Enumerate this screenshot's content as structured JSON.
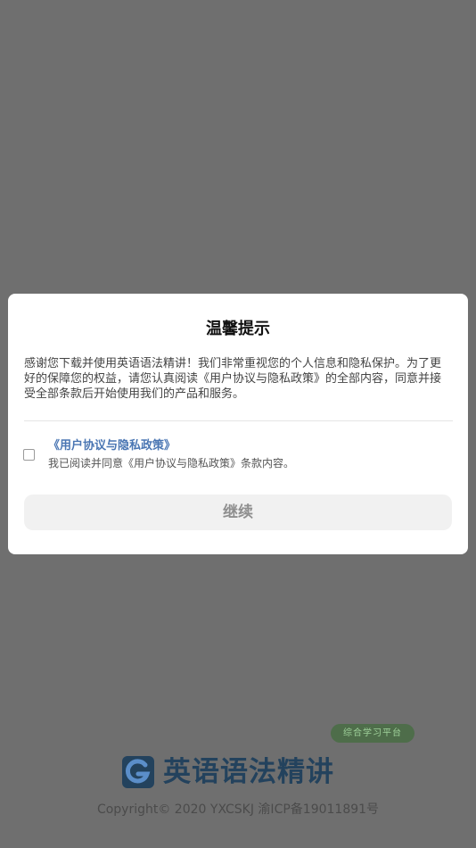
{
  "dialog": {
    "title": "温馨提示",
    "body": "感谢您下载并使用英语语法精讲！我们非常重视您的个人信息和隐私保护。为了更好的保障您的权益，请您认真阅读《用户协议与隐私政策》的全部内容，同意并接受全部条款后开始使用我们的产品和服务。",
    "agreement_link": "《用户协议与隐私政策》",
    "agreement_desc": "我已阅读并同意《用户协议与隐私政策》条款内容。",
    "agreement_checked": false,
    "continue_label": "继续"
  },
  "branding": {
    "badge": "综合学习平台",
    "app_name": "英语语法精讲",
    "copyright": "Copyright© 2020 YXCSKJ 渝ICP备19011891号",
    "logo_icon": "g-logo-icon"
  },
  "colors": {
    "overlay": "#6f6f6f",
    "link": "#4a76b3",
    "brand": "#23425d",
    "button_bg": "#f1f1f1",
    "button_text": "#8f8f8f"
  }
}
